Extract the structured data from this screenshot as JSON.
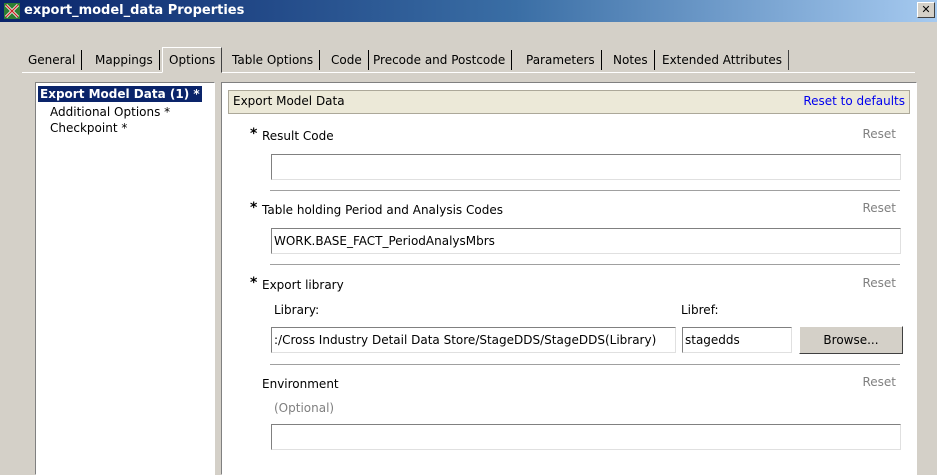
{
  "window": {
    "title": "export_model_data Properties"
  },
  "tabs": [
    "General",
    "Mappings",
    "Options",
    "Table Options",
    "Code",
    "Precode and Postcode",
    "Parameters",
    "Notes",
    "Extended Attributes"
  ],
  "tree": {
    "selected": "Export Model Data (1) *",
    "items": [
      "Additional Options *",
      "Checkpoint *"
    ]
  },
  "section": {
    "title": "Export Model Data",
    "reset_all": "Reset to defaults"
  },
  "result_code": {
    "label": "Result Code",
    "reset": "Reset",
    "value": ""
  },
  "table_codes": {
    "label": "Table holding Period and Analysis Codes",
    "reset": "Reset",
    "value": "WORK.BASE_FACT_PeriodAnalysMbrs"
  },
  "export_library": {
    "label": "Export library",
    "reset": "Reset",
    "library_label": "Library:",
    "library_value": ":/Cross Industry Detail Data Store/StageDDS/StageDDS(Library)",
    "libref_label": "Libref:",
    "libref_value": "stagedds",
    "browse": "Browse..."
  },
  "environment": {
    "label": "Environment",
    "reset": "Reset",
    "hint": "(Optional)",
    "value": ""
  },
  "required_marker": "*"
}
